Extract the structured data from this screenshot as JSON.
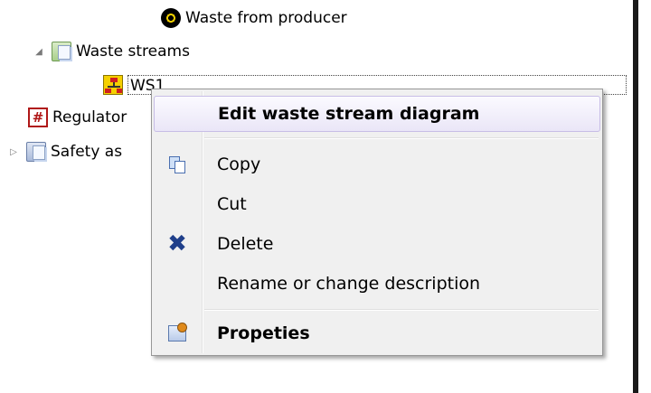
{
  "tree": {
    "items": [
      {
        "label": "Waste from producer",
        "icon": "radiation-icon"
      },
      {
        "label": "Waste streams",
        "icon": "folder-icon",
        "expander": "◢"
      },
      {
        "label": "WS1",
        "icon": "diagram-icon"
      },
      {
        "label": "Regulator",
        "icon": "hash-icon",
        "icon_text": "#"
      },
      {
        "label": "Safety as",
        "icon": "folder-icon",
        "expander": "▷"
      }
    ]
  },
  "context_menu": {
    "items": [
      {
        "label": "Edit waste stream diagram",
        "bold": true,
        "highlighted": true
      },
      {
        "label": "Copy",
        "icon": "copy-icon"
      },
      {
        "label": "Cut"
      },
      {
        "label": "Delete",
        "icon": "delete-icon",
        "icon_glyph": "✖"
      },
      {
        "label": "Rename or change description"
      },
      {
        "label": "Propeties",
        "bold": true,
        "icon": "properties-icon"
      }
    ]
  },
  "colors": {
    "menu_background": "#f0f0f0",
    "menu_highlight": "#eae6f7",
    "menu_border": "#979797"
  }
}
